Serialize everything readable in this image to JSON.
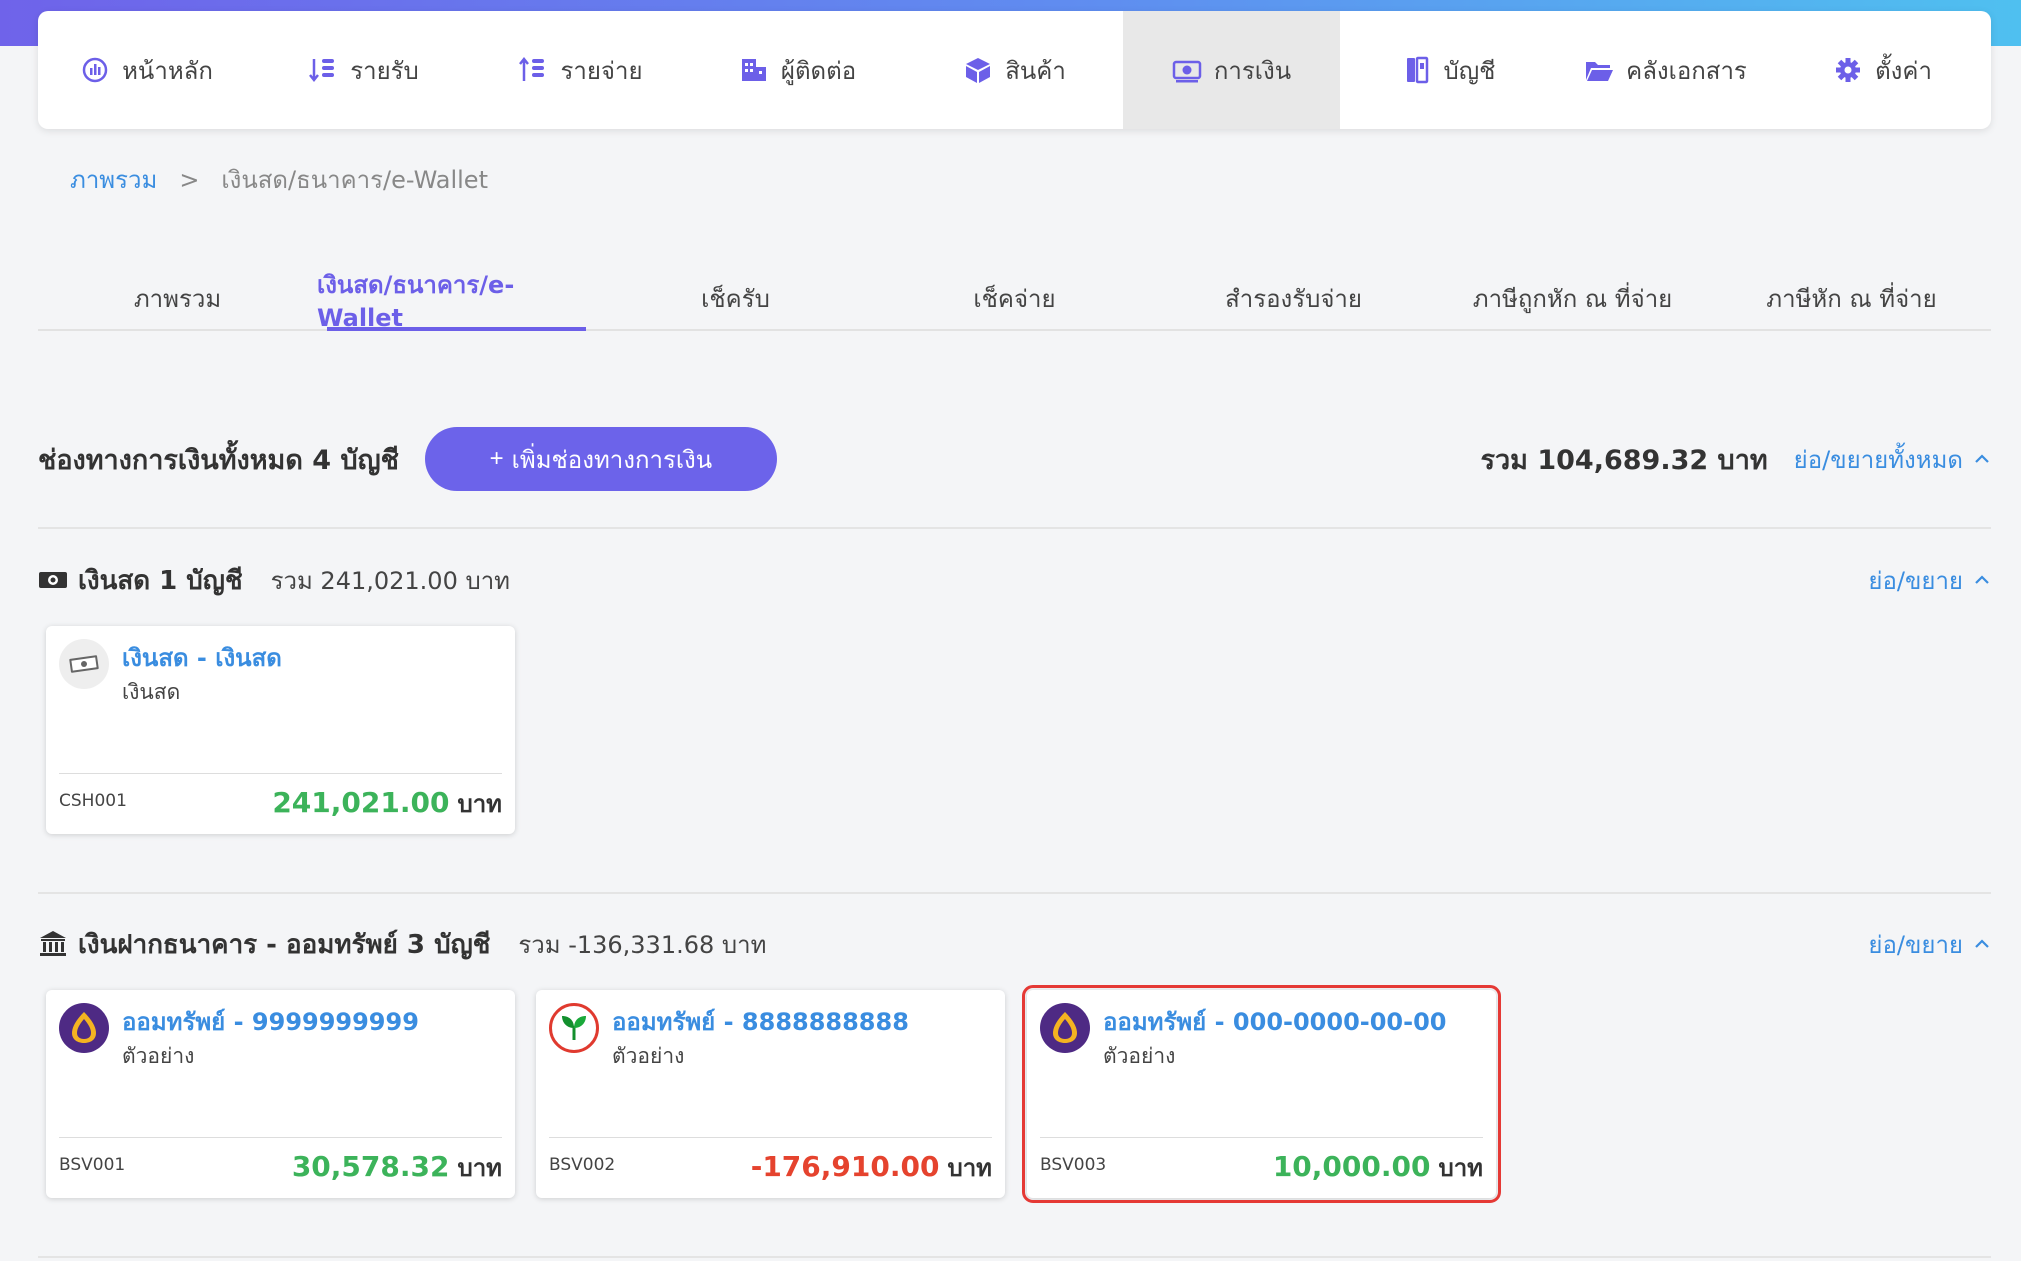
{
  "nav": {
    "items": [
      {
        "label": "หน้าหลัก",
        "icon": "dashboard-icon"
      },
      {
        "label": "รายรับ",
        "icon": "income-icon"
      },
      {
        "label": "รายจ่าย",
        "icon": "expense-icon"
      },
      {
        "label": "ผู้ติดต่อ",
        "icon": "contacts-icon"
      },
      {
        "label": "สินค้า",
        "icon": "box-icon"
      },
      {
        "label": "การเงิน",
        "icon": "money-icon"
      },
      {
        "label": "บัญชี",
        "icon": "ledger-icon"
      },
      {
        "label": "คลังเอกสาร",
        "icon": "folder-icon"
      },
      {
        "label": "ตั้งค่า",
        "icon": "gear-icon"
      }
    ],
    "active_index": 5
  },
  "breadcrumb": {
    "root": "ภาพรวม",
    "separator": ">",
    "current": "เงินสด/ธนาคาร/e-Wallet"
  },
  "tabs": {
    "items": [
      "ภาพรวม",
      "เงินสด/ธนาคาร/e-Wallet",
      "เช็ครับ",
      "เช็คจ่าย",
      "สำรองรับจ่าย",
      "ภาษีถูกหัก ณ ที่จ่าย",
      "ภาษีหัก ณ ที่จ่าย"
    ],
    "active_index": 1
  },
  "summary": {
    "title": "ช่องทางการเงินทั้งหมด 4 บัญชี",
    "add_button": "เพิ่มช่องทางการเงิน",
    "total": "รวม 104,689.32 บาท",
    "collapse_all": "ย่อ/ขยายทั้งหมด"
  },
  "sections": {
    "cash": {
      "title": "เงินสด 1 บัญชี",
      "sum": "รวม 241,021.00 บาท",
      "toggle": "ย่อ/ขยาย",
      "cards": [
        {
          "name": "เงินสด - เงินสด",
          "sub": "เงินสด",
          "code": "CSH001",
          "amount": "241,021.00",
          "unit": "บาท",
          "sign": "positive"
        }
      ]
    },
    "bank": {
      "title": "เงินฝากธนาคาร - ออมทรัพย์ 3 บัญชี",
      "sum": "รวม -136,331.68 บาท",
      "toggle": "ย่อ/ขยาย",
      "cards": [
        {
          "name": "ออมทรัพย์ - 9999999999",
          "sub": "ตัวอย่าง",
          "code": "BSV001",
          "amount": "30,578.32",
          "unit": "บาท",
          "sign": "positive",
          "logo": "scb-logo"
        },
        {
          "name": "ออมทรัพย์ - 8888888888",
          "sub": "ตัวอย่าง",
          "code": "BSV002",
          "amount": "-176,910.00",
          "unit": "บาท",
          "sign": "negative",
          "logo": "kbank-logo"
        },
        {
          "name": "ออมทรัพย์ - 000-0000-00-00",
          "sub": "ตัวอย่าง",
          "code": "BSV003",
          "amount": "10,000.00",
          "unit": "บาท",
          "sign": "positive",
          "logo": "scb-logo"
        }
      ]
    }
  },
  "colors": {
    "accent": "#6c63ea",
    "link": "#3a8de0",
    "positive": "#3cb35a",
    "negative": "#e5432e",
    "highlight": "#e53935"
  }
}
